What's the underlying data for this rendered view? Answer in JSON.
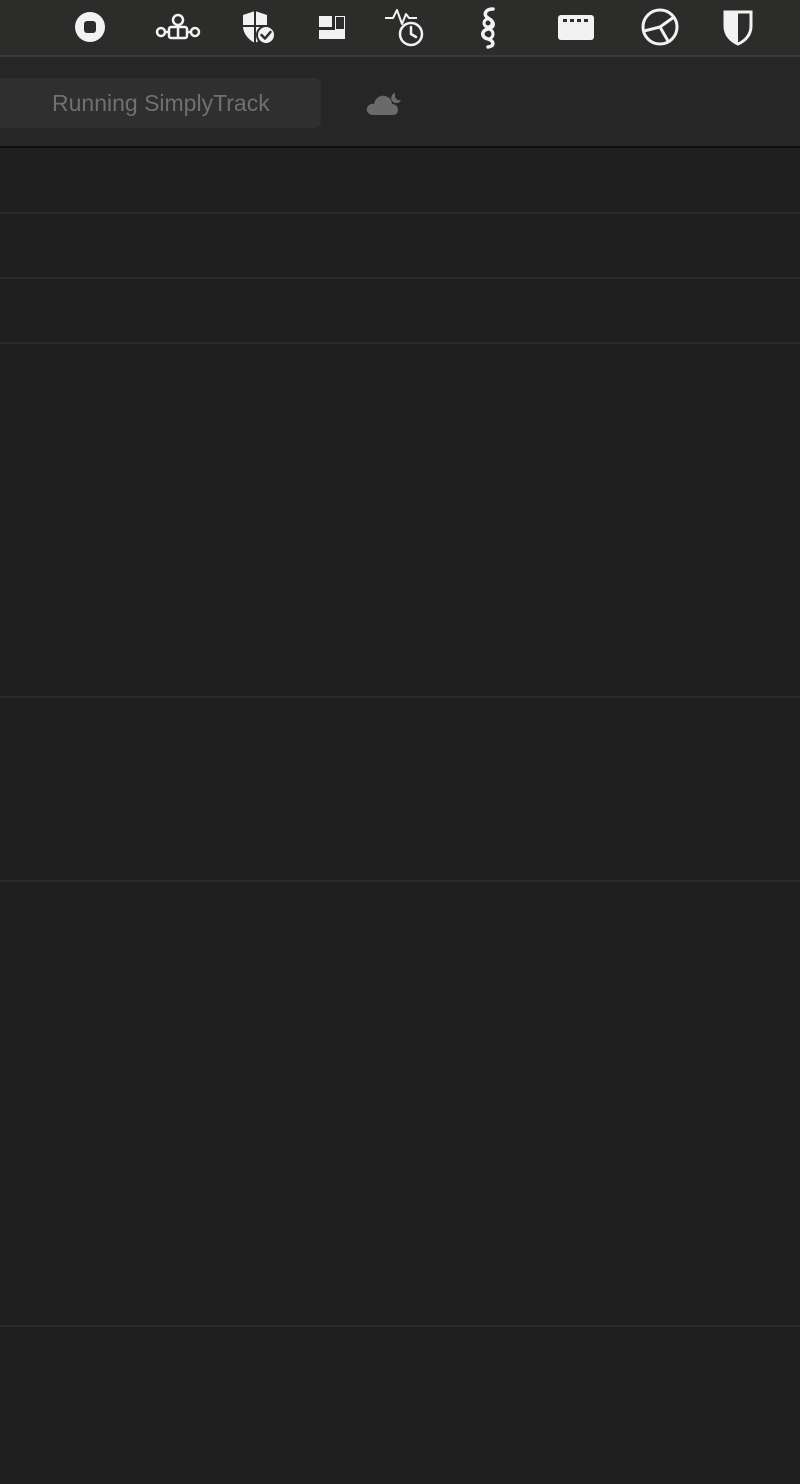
{
  "menubar": {
    "icons": [
      {
        "name": "record-stop-icon"
      },
      {
        "name": "network-nodes-icon"
      },
      {
        "name": "shield-check-icon"
      },
      {
        "name": "window-layout-icon"
      },
      {
        "name": "activity-timer-icon"
      },
      {
        "name": "snake-script-icon"
      },
      {
        "name": "keyboard-display-icon"
      },
      {
        "name": "globe-network-icon"
      },
      {
        "name": "privacy-shield-icon"
      }
    ]
  },
  "toolbar": {
    "status_text": "Running SimplyTrack",
    "weather_icon": "cloud-moon-icon"
  },
  "colors": {
    "background": "#1f1f1f",
    "menubar": "#2c2c2b",
    "toolbar": "#262626",
    "status_text": "#707070"
  }
}
